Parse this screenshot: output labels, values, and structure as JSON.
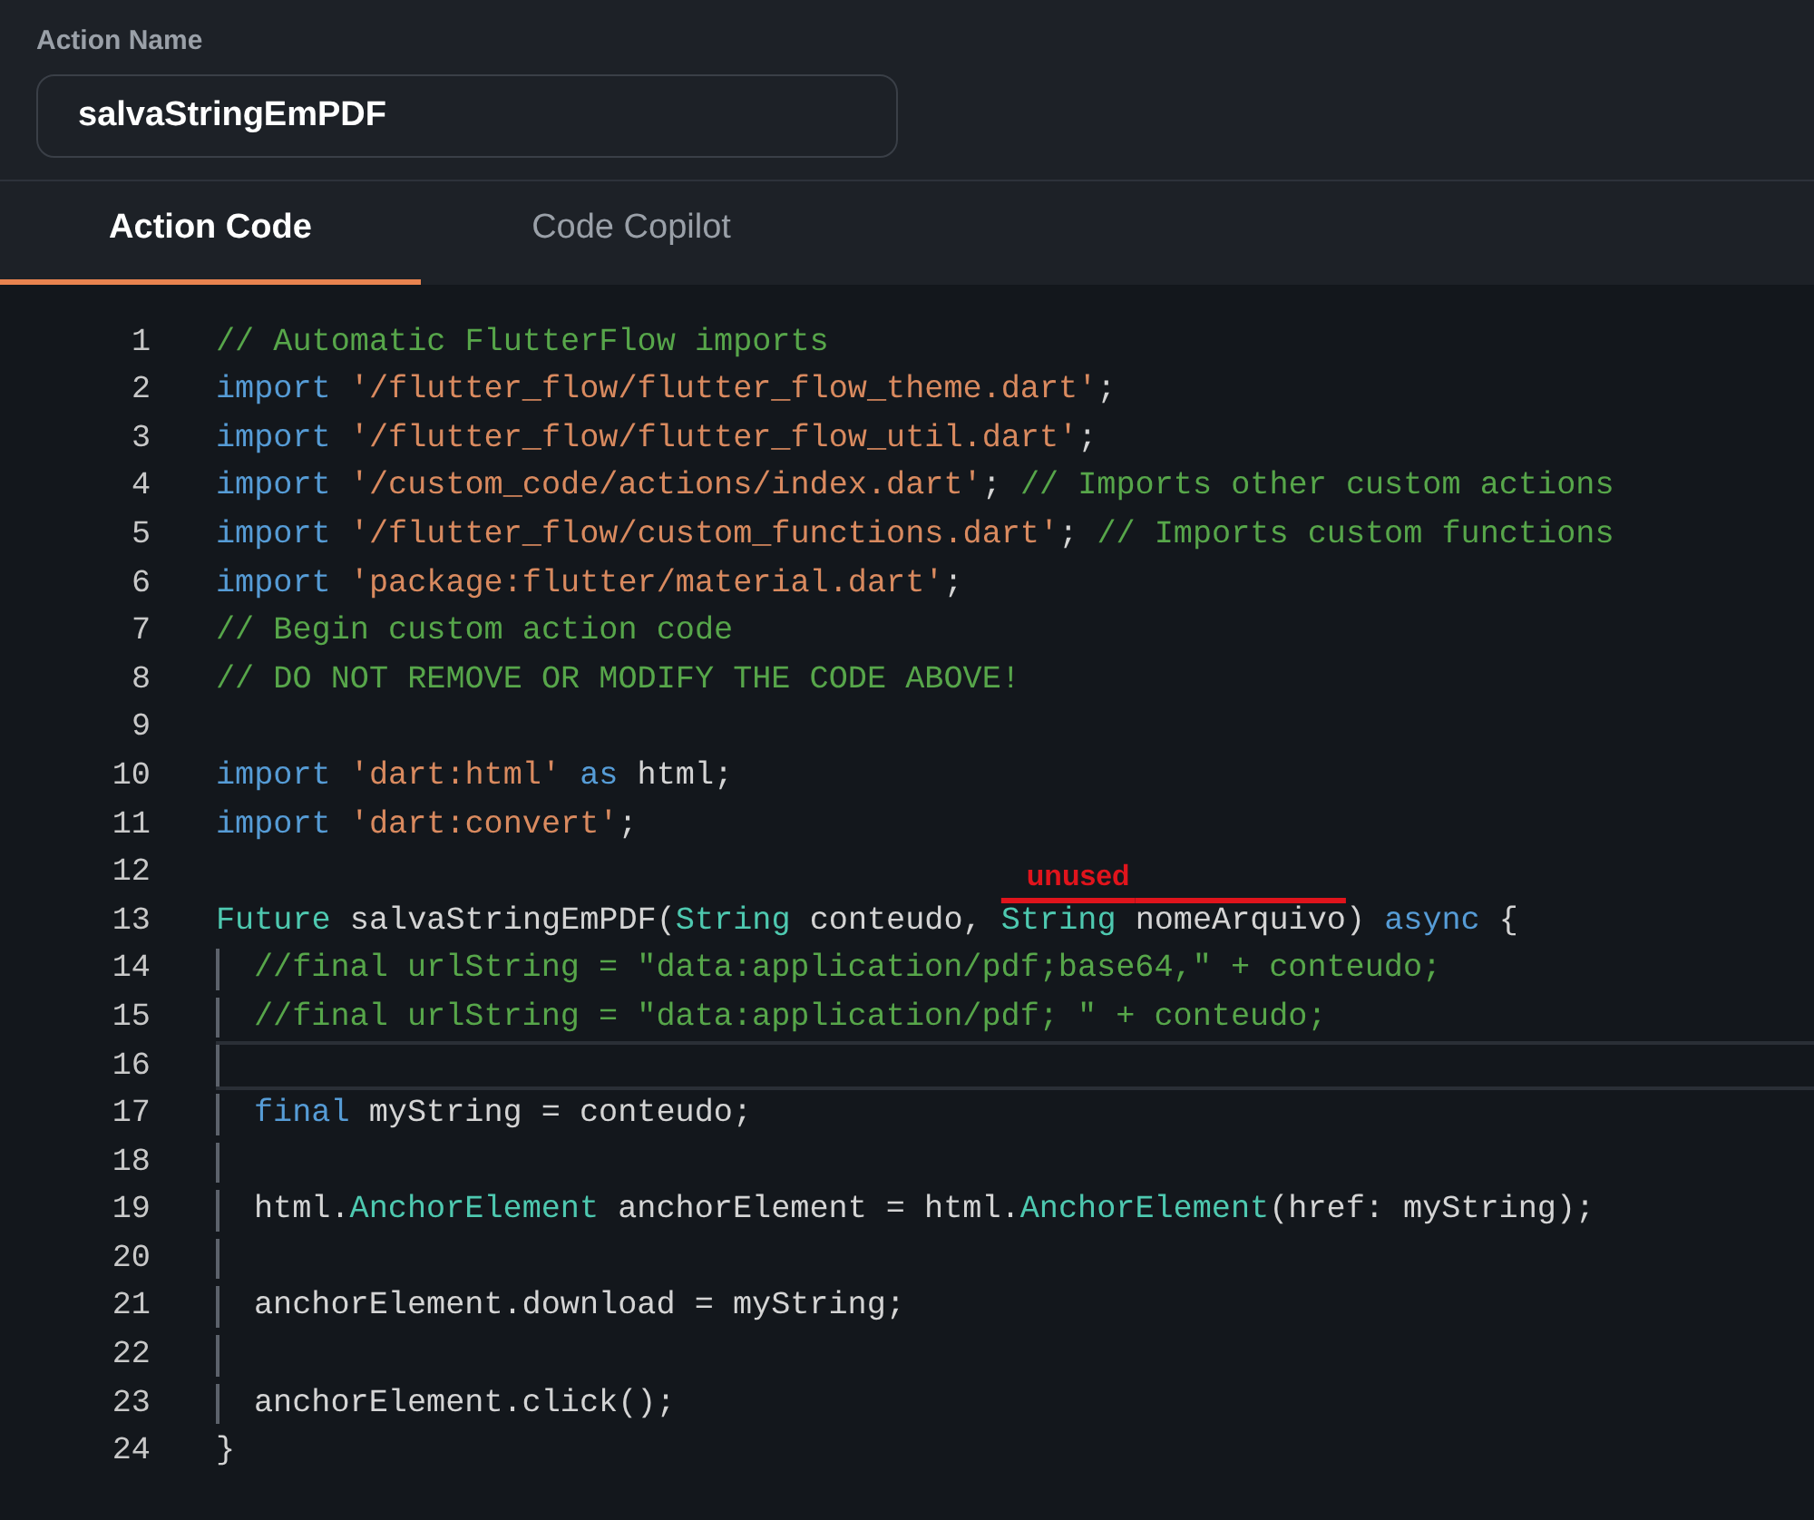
{
  "action_name": {
    "label": "Action Name",
    "value": "salvaStringEmPDF"
  },
  "tabs": [
    {
      "label": "Action Code",
      "selected": true
    },
    {
      "label": "Code Copilot",
      "selected": false
    }
  ],
  "code": {
    "lines": [
      {
        "number": "1",
        "indented": false,
        "selected": false,
        "tokens": [
          {
            "kind": "comment",
            "text": "// Automatic FlutterFlow imports"
          }
        ]
      },
      {
        "number": "2",
        "indented": false,
        "selected": false,
        "tokens": [
          {
            "kind": "keyword",
            "text": "import "
          },
          {
            "kind": "string",
            "text": "'/flutter_flow/flutter_flow_theme.dart'"
          },
          {
            "kind": "plain",
            "text": ";"
          }
        ]
      },
      {
        "number": "3",
        "indented": false,
        "selected": false,
        "tokens": [
          {
            "kind": "keyword",
            "text": "import "
          },
          {
            "kind": "string",
            "text": "'/flutter_flow/flutter_flow_util.dart'"
          },
          {
            "kind": "plain",
            "text": ";"
          }
        ]
      },
      {
        "number": "4",
        "indented": false,
        "selected": false,
        "tokens": [
          {
            "kind": "keyword",
            "text": "import "
          },
          {
            "kind": "string",
            "text": "'/custom_code/actions/index.dart'"
          },
          {
            "kind": "plain",
            "text": "; "
          },
          {
            "kind": "comment",
            "text": "// Imports other custom actions"
          }
        ]
      },
      {
        "number": "5",
        "indented": false,
        "selected": false,
        "tokens": [
          {
            "kind": "keyword",
            "text": "import "
          },
          {
            "kind": "string",
            "text": "'/flutter_flow/custom_functions.dart'"
          },
          {
            "kind": "plain",
            "text": "; "
          },
          {
            "kind": "comment",
            "text": "// Imports custom functions"
          }
        ]
      },
      {
        "number": "6",
        "indented": false,
        "selected": false,
        "tokens": [
          {
            "kind": "keyword",
            "text": "import "
          },
          {
            "kind": "string",
            "text": "'package:flutter/material.dart'"
          },
          {
            "kind": "plain",
            "text": ";"
          }
        ]
      },
      {
        "number": "7",
        "indented": false,
        "selected": false,
        "tokens": [
          {
            "kind": "comment",
            "text": "// Begin custom action code"
          }
        ]
      },
      {
        "number": "8",
        "indented": false,
        "selected": false,
        "tokens": [
          {
            "kind": "comment",
            "text": "// DO NOT REMOVE OR MODIFY THE CODE ABOVE!"
          }
        ]
      },
      {
        "number": "9",
        "indented": false,
        "selected": false
      },
      {
        "number": "10",
        "indented": false,
        "selected": false,
        "tokens": [
          {
            "kind": "keyword",
            "text": "import "
          },
          {
            "kind": "string",
            "text": "'dart:html' "
          },
          {
            "kind": "keyword",
            "text": "as"
          },
          {
            "kind": "plain",
            "text": " html;"
          }
        ]
      },
      {
        "number": "11",
        "indented": false,
        "selected": false,
        "tokens": [
          {
            "kind": "keyword",
            "text": "import "
          },
          {
            "kind": "string",
            "text": "'dart:convert'"
          },
          {
            "kind": "plain",
            "text": ";"
          }
        ]
      },
      {
        "number": "12",
        "indented": false,
        "selected": false
      },
      {
        "number": "13",
        "indented": false,
        "selected": false,
        "annotation": "unused",
        "tokens": [
          {
            "kind": "type",
            "text": "Future"
          },
          {
            "kind": "plain",
            "text": " salvaStringEmPDF("
          },
          {
            "kind": "type",
            "text": "String"
          },
          {
            "kind": "plain",
            "text": " conteudo, "
          },
          {
            "kind": "type",
            "text": "String ",
            "struck": true
          },
          {
            "kind": "plain",
            "text": "nomeArquivo",
            "struck": true
          },
          {
            "kind": "plain",
            "text": ") "
          },
          {
            "kind": "keyword",
            "text": "async"
          },
          {
            "kind": "plain",
            "text": " {"
          }
        ]
      },
      {
        "number": "14",
        "indented": true,
        "selected": false,
        "tokens": [
          {
            "kind": "comment",
            "text": "//final urlString = \"data:application/pdf;base64,\" + conteudo;"
          }
        ]
      },
      {
        "number": "15",
        "indented": true,
        "selected": false,
        "tokens": [
          {
            "kind": "comment",
            "text": "//final urlString = \"data:application/pdf; \" + conteudo;"
          }
        ]
      },
      {
        "number": "16",
        "indented": true,
        "selected": true
      },
      {
        "number": "17",
        "indented": true,
        "selected": false,
        "tokens": [
          {
            "kind": "keyword",
            "text": "final"
          },
          {
            "kind": "plain",
            "text": " myString = conteudo;"
          }
        ]
      },
      {
        "number": "18",
        "indented": true,
        "selected": false
      },
      {
        "number": "19",
        "indented": true,
        "selected": false,
        "tokens": [
          {
            "kind": "plain",
            "text": "html."
          },
          {
            "kind": "type",
            "text": "AnchorElement"
          },
          {
            "kind": "plain",
            "text": " anchorElement = html."
          },
          {
            "kind": "type",
            "text": "AnchorElement"
          },
          {
            "kind": "plain",
            "text": "(href: myString);"
          }
        ]
      },
      {
        "number": "20",
        "indented": true,
        "selected": false
      },
      {
        "number": "21",
        "indented": true,
        "selected": false,
        "tokens": [
          {
            "kind": "plain",
            "text": "anchorElement.download = myString;"
          }
        ]
      },
      {
        "number": "22",
        "indented": true,
        "selected": false
      },
      {
        "number": "23",
        "indented": true,
        "selected": false,
        "tokens": [
          {
            "kind": "plain",
            "text": "anchorElement.click();"
          }
        ]
      },
      {
        "number": "24",
        "indented": false,
        "selected": false,
        "tokens": [
          {
            "kind": "plain",
            "text": "}"
          }
        ]
      }
    ]
  }
}
